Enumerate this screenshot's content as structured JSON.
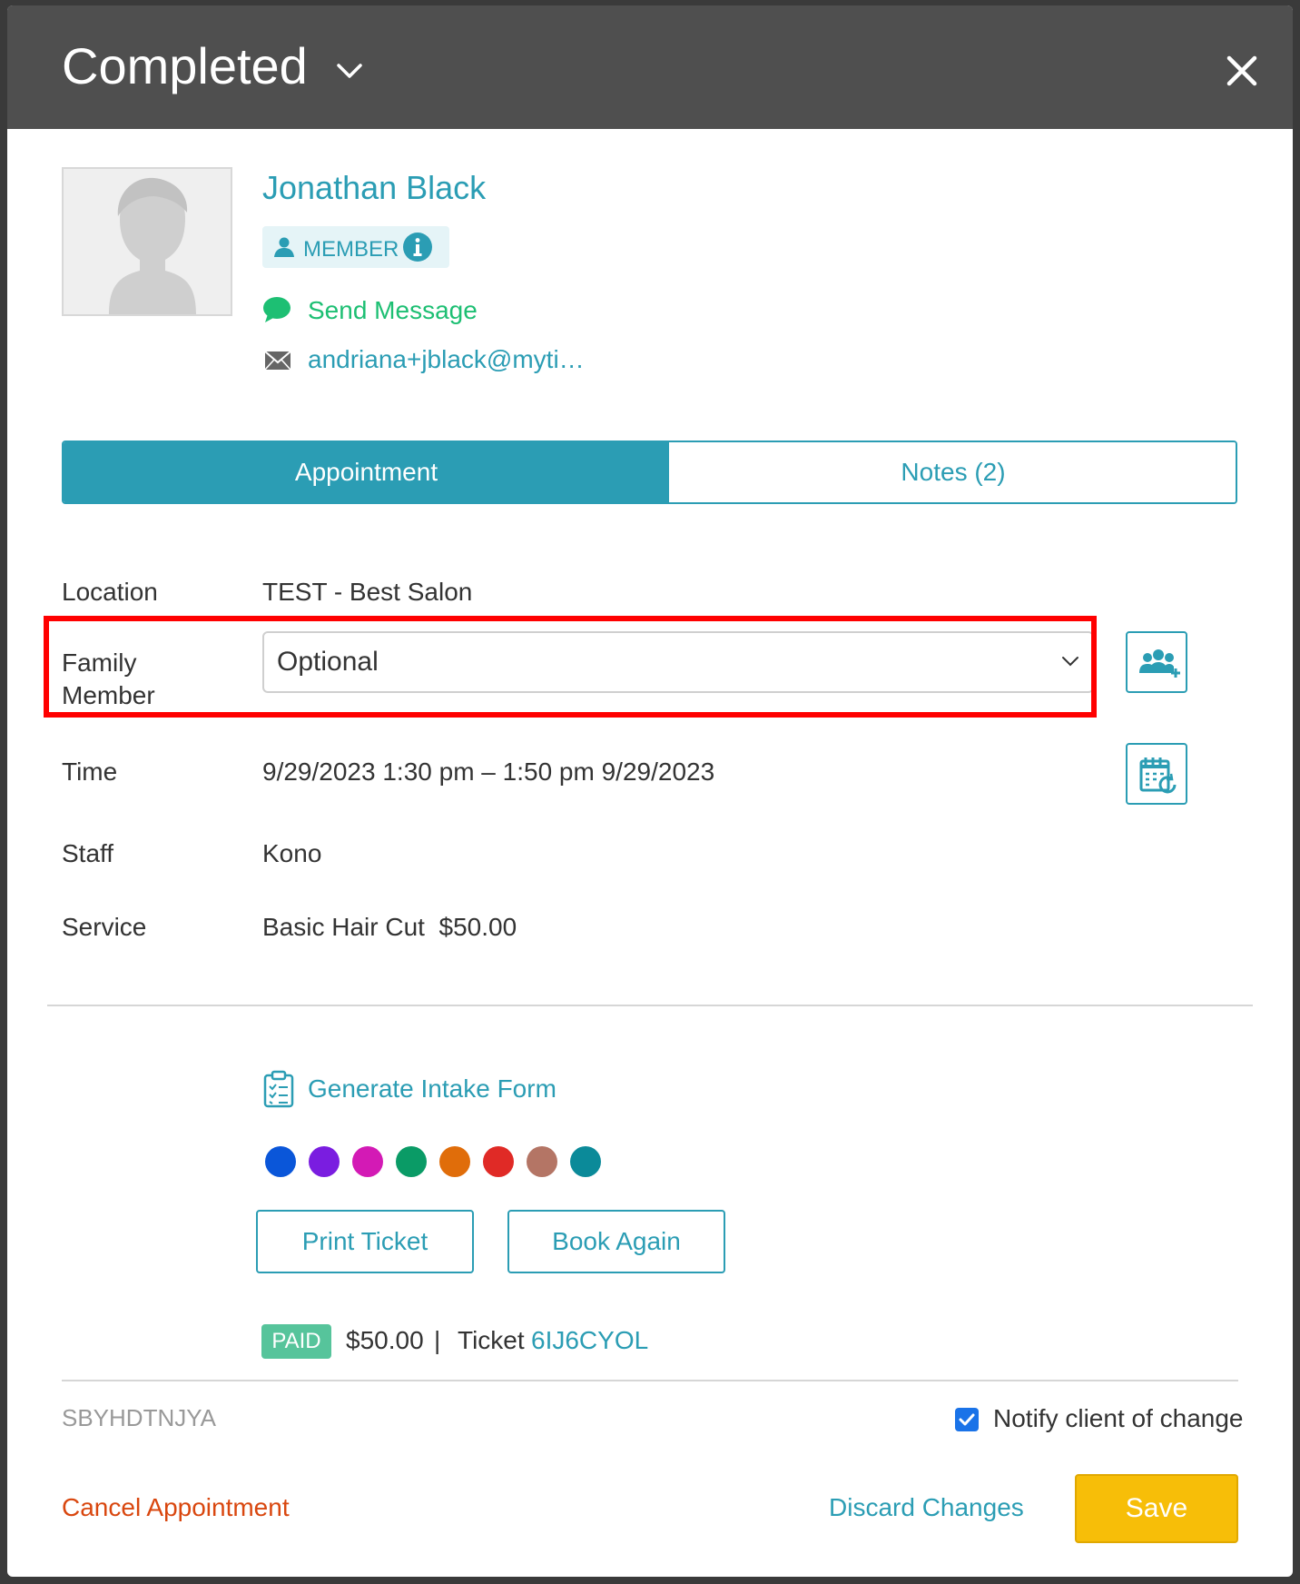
{
  "header": {
    "status_title": "Completed"
  },
  "client": {
    "name": "Jonathan Black",
    "badge": "MEMBER",
    "send_message": "Send Message",
    "email": "andriana+jblack@myti…"
  },
  "tabs": {
    "appointment": "Appointment",
    "notes": "Notes (2)"
  },
  "details": {
    "location_label": "Location",
    "location_value": "TEST - Best Salon",
    "family_label_1": "Family",
    "family_label_2": "Member",
    "family_select_value": "Optional",
    "time_label": "Time",
    "time_value": "9/29/2023 1:30 pm – 1:50 pm 9/29/2023",
    "staff_label": "Staff",
    "staff_value": "Kono",
    "service_label": "Service",
    "service_value": "Basic Hair Cut  $50.00"
  },
  "actions": {
    "intake_form": "Generate Intake Form",
    "print_ticket": "Print Ticket",
    "book_again": "Book Again"
  },
  "swatches": [
    "#0a56d9",
    "#7a1de0",
    "#d31ab5",
    "#0a9b66",
    "#e06d0a",
    "#e02a26",
    "#b47565",
    "#0b8a99"
  ],
  "payment": {
    "paid_badge": "PAID",
    "amount": "$50.00",
    "separator": "|",
    "ticket_label": "Ticket",
    "ticket_code": "6IJ6CYOL"
  },
  "footer": {
    "code": "SBYHDTNJYA",
    "notify_label": "Notify client of change",
    "cancel": "Cancel Appointment",
    "discard": "Discard Changes",
    "save": "Save"
  },
  "colors": {
    "accent": "#2b9db4",
    "save": "#f7be08",
    "cancel": "#d9470f",
    "message": "#1dbf73"
  }
}
